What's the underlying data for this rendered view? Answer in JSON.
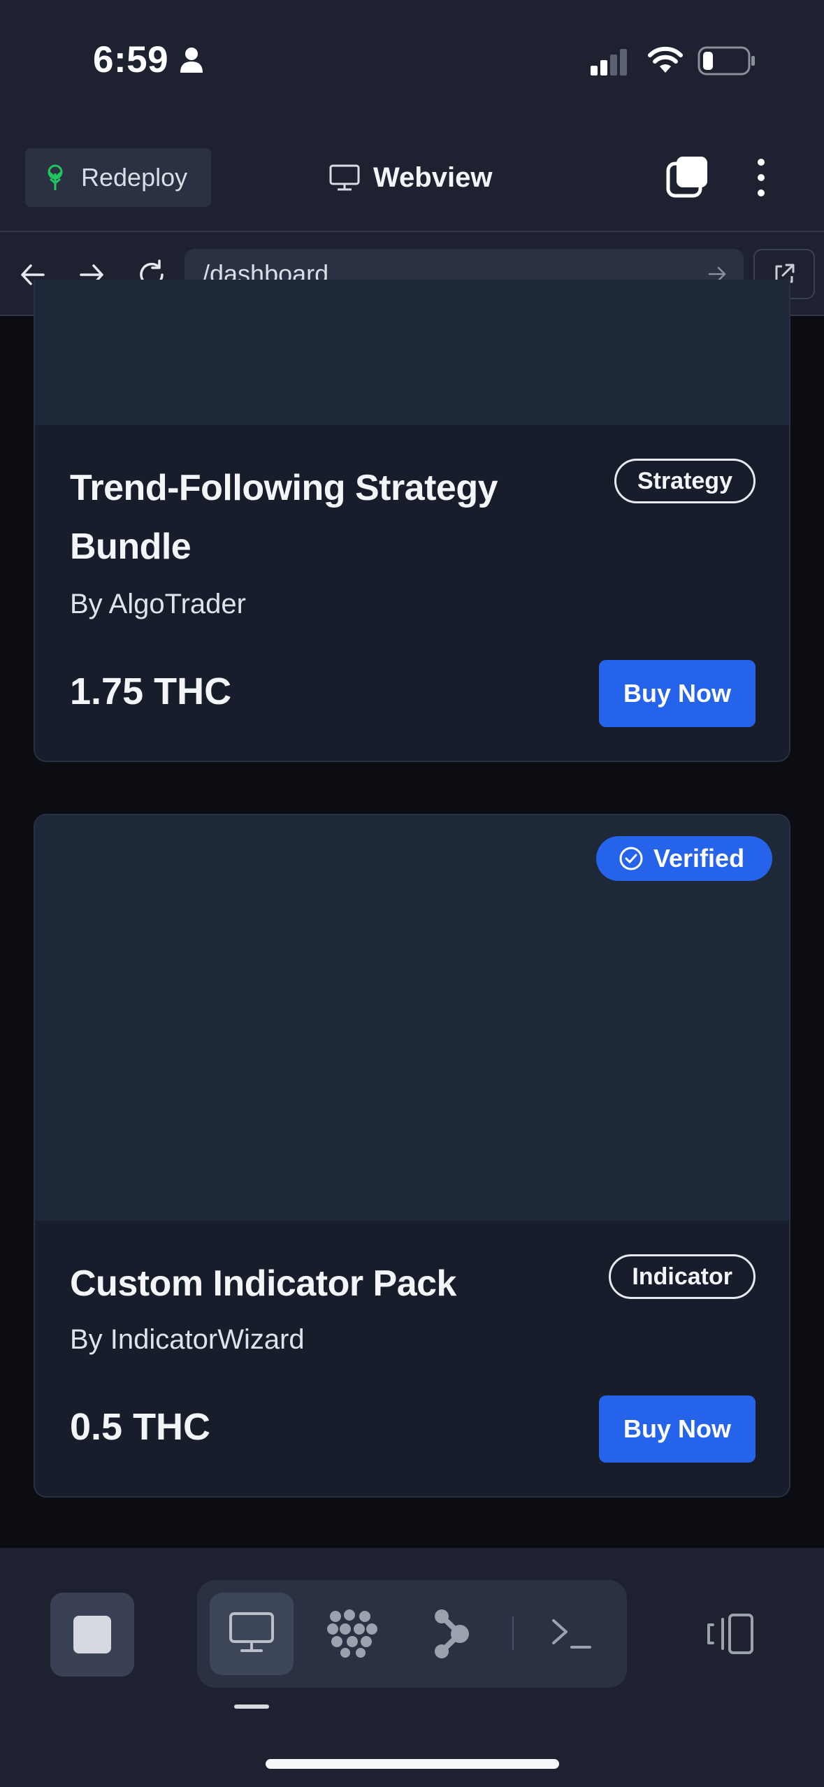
{
  "status_bar": {
    "time": "6:59"
  },
  "app_header": {
    "redeploy_label": "Redeploy",
    "title": "Webview"
  },
  "browser": {
    "url": "/dashboard"
  },
  "cards": [
    {
      "title_line1": "Trend-Following Strategy",
      "title_line2": "Bundle",
      "author": "By AlgoTrader",
      "category": "Strategy",
      "price": "1.75 THC",
      "buy_label": "Buy Now"
    },
    {
      "badge": "Verified",
      "title_line1": "Custom Indicator Pack",
      "author": "By IndicatorWizard",
      "category": "Indicator",
      "price": "0.5 THC",
      "buy_label": "Buy Now"
    }
  ],
  "colors": {
    "accent": "#2563eb",
    "header_bg": "#1d2130",
    "card_bg": "#171d2a",
    "redeploy_icon": "#22c55e"
  },
  "icons": [
    "person-icon",
    "signal-icon",
    "wifi-icon",
    "battery-icon",
    "tree-icon",
    "monitor-icon",
    "tabs-icon",
    "kebab-menu-icon",
    "back-arrow-icon",
    "forward-arrow-icon",
    "reload-icon",
    "go-arrow-icon",
    "external-link-icon",
    "check-circle-icon",
    "stop-icon",
    "grid-dots-icon",
    "branch-icon",
    "terminal-icon",
    "device-rotate-icon"
  ]
}
